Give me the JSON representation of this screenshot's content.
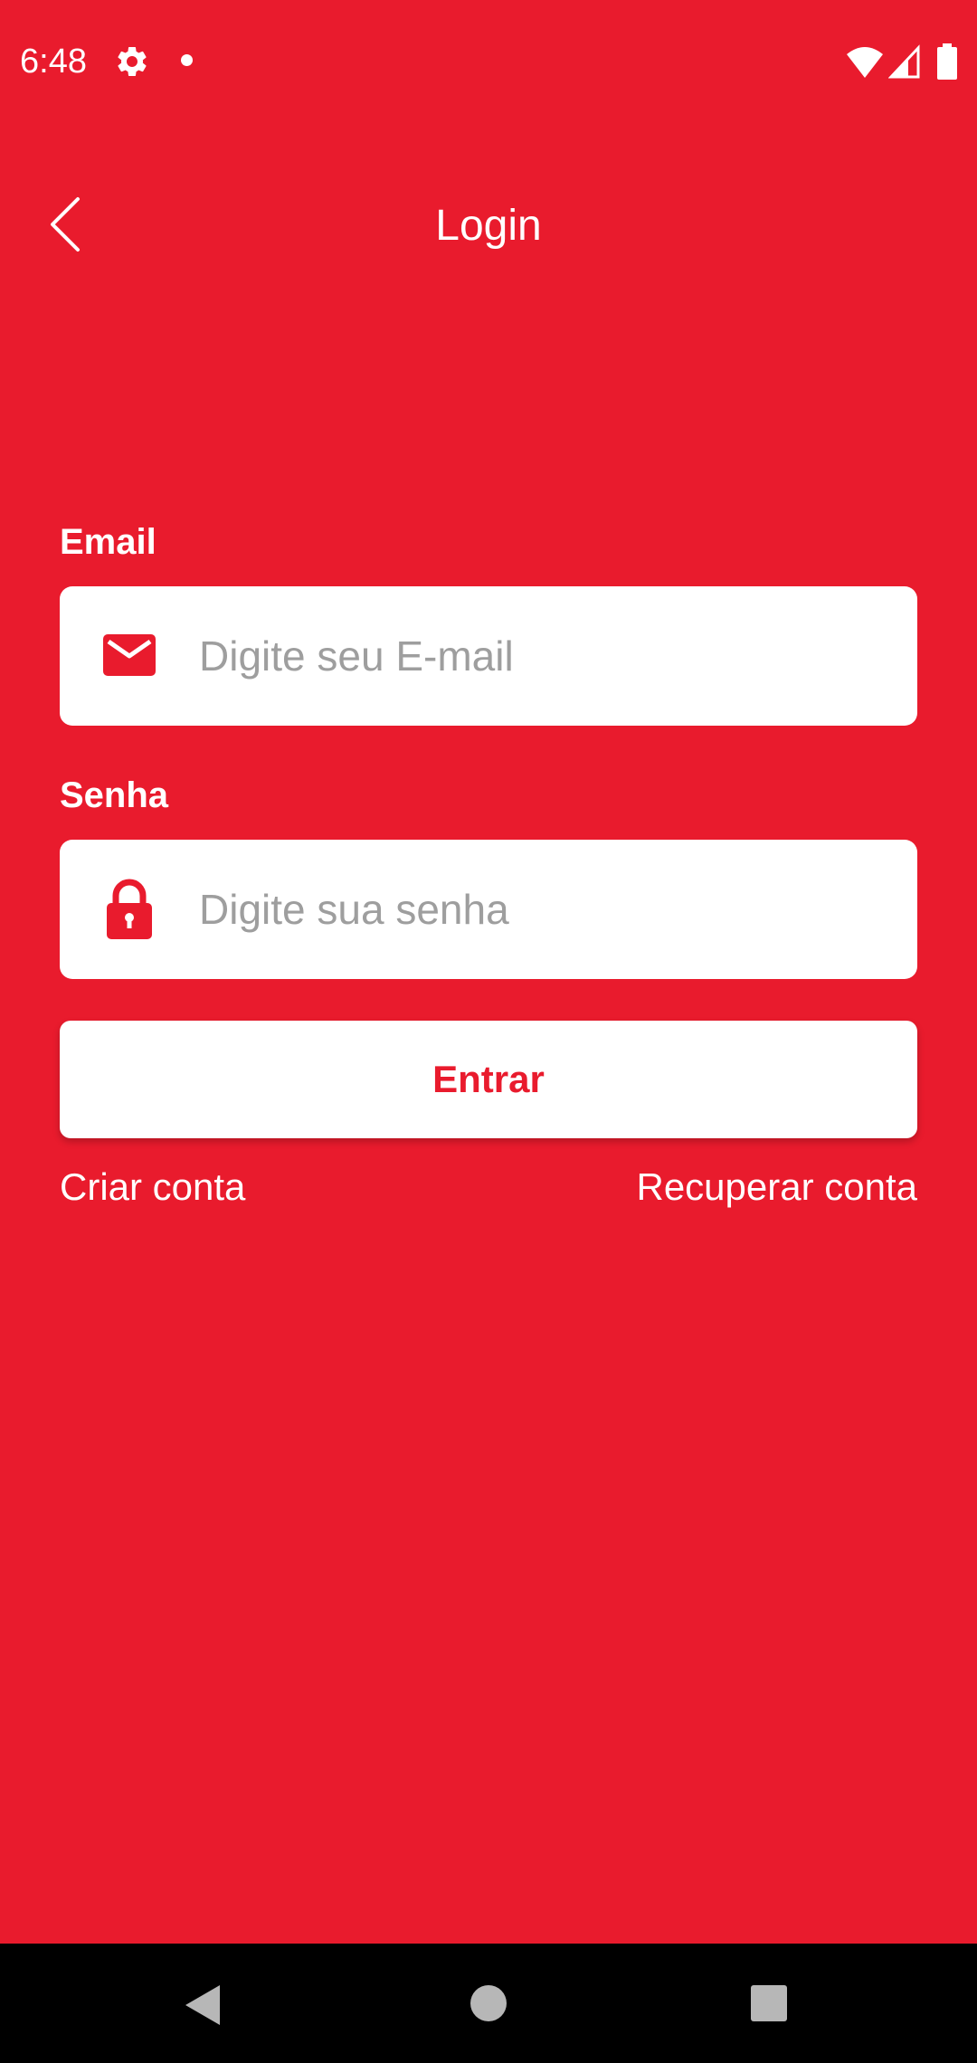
{
  "status_bar": {
    "time": "6:48",
    "icons": [
      "gear-icon",
      "notification-dot-icon",
      "wifi-icon",
      "signal-icon",
      "battery-icon"
    ]
  },
  "header": {
    "title": "Login",
    "back_icon": "chevron-left-icon"
  },
  "form": {
    "email": {
      "label": "Email",
      "placeholder": "Digite seu E-mail",
      "value": "",
      "icon": "mail-icon"
    },
    "password": {
      "label": "Senha",
      "placeholder": "Digite sua senha",
      "value": "",
      "icon": "lock-icon"
    },
    "submit_label": "Entrar"
  },
  "links": {
    "create_account": "Criar conta",
    "recover_account": "Recuperar conta"
  },
  "nav_bar": {
    "buttons": [
      "back-icon",
      "home-icon",
      "recents-icon"
    ]
  },
  "colors": {
    "background": "#E91B2D",
    "accent": "#E91B2D",
    "field_background": "#FFFFFF",
    "placeholder": "#9E9E9E",
    "nav_bar": "#000000"
  }
}
